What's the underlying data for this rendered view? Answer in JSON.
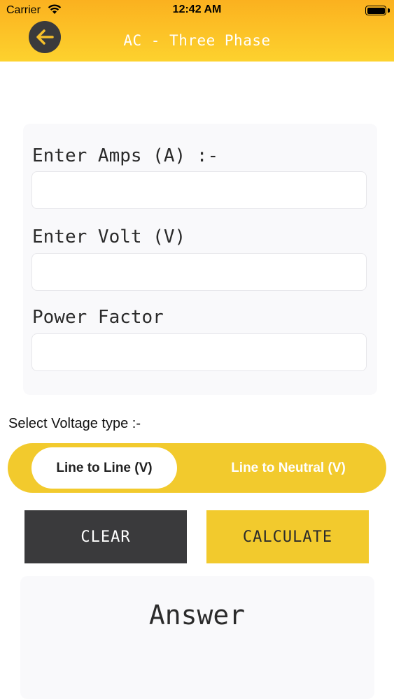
{
  "status_bar": {
    "carrier": "Carrier",
    "time": "12:42 AM"
  },
  "header": {
    "title": "AC - Three Phase",
    "back_icon": "arrow-left-icon",
    "gradient_top": "#FBB11F",
    "gradient_bottom": "#FDD22E"
  },
  "form": {
    "amps_label": "Enter Amps (A) :-",
    "amps_value": "",
    "volt_label": "Enter Volt (V)",
    "volt_value": "",
    "pf_label": "Power Factor",
    "pf_value": ""
  },
  "voltage_type": {
    "label": "Select Voltage type :-",
    "options": [
      "Line to Line (V)",
      "Line to Neutral (V)"
    ],
    "selected": "Line to Line (V)"
  },
  "buttons": {
    "clear": "CLEAR",
    "calculate": "CALCULATE"
  },
  "answer": {
    "text": "Answer"
  },
  "colors": {
    "accent": "#F2CA2D",
    "dark": "#3A3A3C"
  }
}
